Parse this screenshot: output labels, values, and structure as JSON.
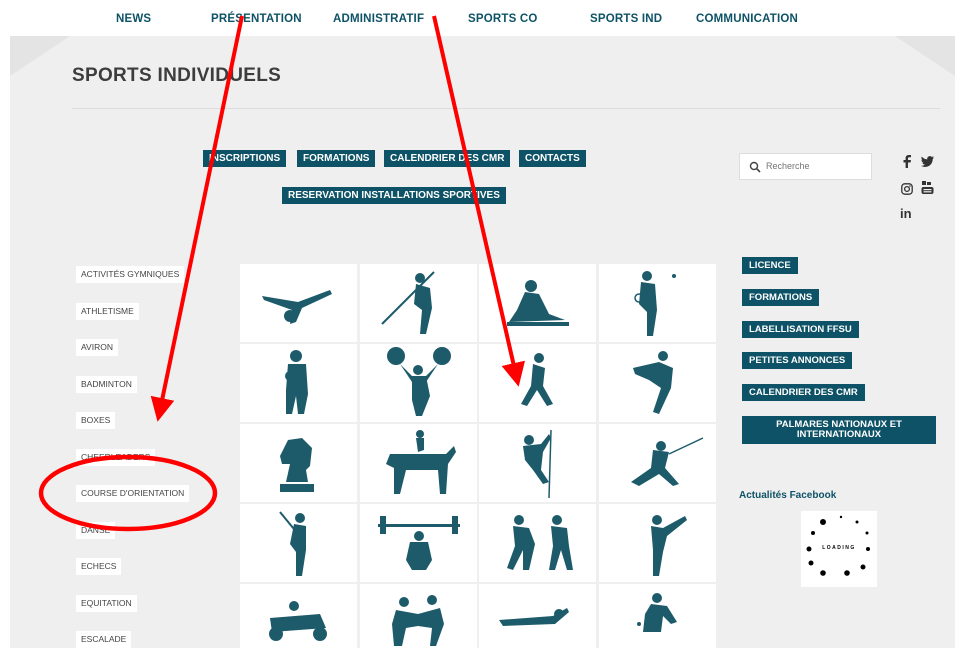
{
  "nav": {
    "items": [
      "NEWS",
      "PRÉSENTATION",
      "ADMINISTRATIF",
      "SPORTS CO",
      "SPORTS IND",
      "COMMUNICATION"
    ]
  },
  "page": {
    "title": "SPORTS INDIVIDUELS"
  },
  "top_buttons": {
    "inscriptions": "INSCRIPTIONS",
    "formations": "FORMATIONS",
    "calendrier": "CALENDRIER DES CMR",
    "contacts": "CONTACTS",
    "reservation": "RESERVATION INSTALLATIONS SPORTIVES"
  },
  "sidebar": {
    "items": [
      "ACTIVITÉS GYMNIQUES",
      "ATHLETISME",
      "AVIRON",
      "BADMINTON",
      "BOXES",
      "CHEERLEADERS",
      "COURSE D'ORIENTATION",
      "DANSE",
      "ECHECS",
      "EQUITATION",
      "ESCALADE"
    ]
  },
  "grid": {
    "icons": [
      "gymnastics-icon",
      "javelin-icon",
      "rowing-icon",
      "badminton-icon",
      "boxing-icon",
      "cheerleading-icon",
      "running-icon",
      "dance-icon",
      "chess-knight-icon",
      "equestrian-icon",
      "climbing-icon",
      "fencing-icon",
      "golf-icon",
      "weightlifting-icon",
      "judo-icon",
      "taekwondo-icon",
      "karting-icon",
      "wrestling-icon",
      "swimming-icon",
      "tennis-icon"
    ],
    "color": "#1d5b6b"
  },
  "search": {
    "placeholder": "Recherche"
  },
  "right_buttons": {
    "licence": "LICENCE",
    "formations": "FORMATIONS",
    "labellisation": "LABELLISATION FFSU",
    "annonces": "PETITES ANNONCES",
    "calendrier": "CALENDRIER DES CMR",
    "palmares_line1": "PALMARES NATIONAUX ET",
    "palmares_line2": "INTERNATIONAUX"
  },
  "facebook": {
    "title": "Actualités Facebook",
    "loading": "LOADING"
  },
  "colors": {
    "brand": "#0d5266",
    "annotation": "#ff0000",
    "panel": "#efefef"
  }
}
